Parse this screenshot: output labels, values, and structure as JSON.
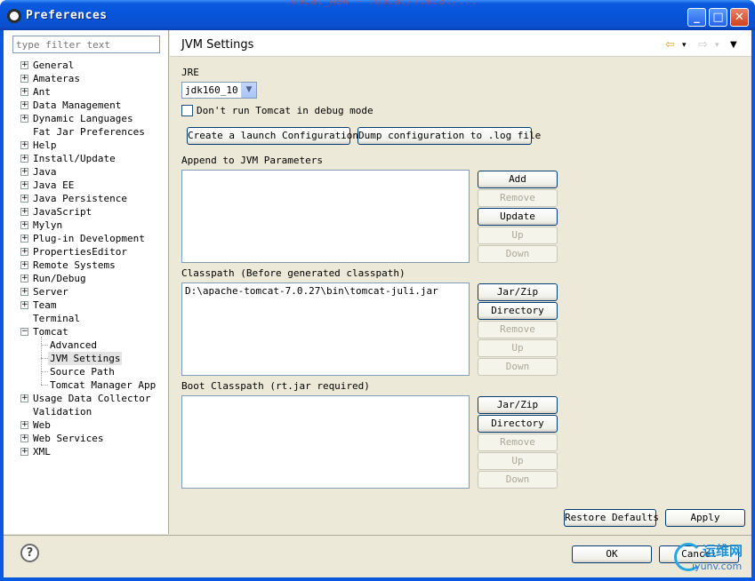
{
  "window": {
    "title": "Preferences",
    "background_title": "Tomcat_new - Tomcat/Tomcat/... ",
    "minimize_label": "_",
    "maximize_label": "□",
    "close_label": "✕"
  },
  "sidebar": {
    "filter_placeholder": "type filter text",
    "items": [
      {
        "label": "General",
        "expand": "+"
      },
      {
        "label": "Amateras",
        "expand": "+"
      },
      {
        "label": "Ant",
        "expand": "+"
      },
      {
        "label": "Data Management",
        "expand": "+"
      },
      {
        "label": "Dynamic Languages",
        "expand": "+"
      },
      {
        "label": "Fat Jar Preferences",
        "expand": ""
      },
      {
        "label": "Help",
        "expand": "+"
      },
      {
        "label": "Install/Update",
        "expand": "+"
      },
      {
        "label": "Java",
        "expand": "+"
      },
      {
        "label": "Java EE",
        "expand": "+"
      },
      {
        "label": "Java Persistence",
        "expand": "+"
      },
      {
        "label": "JavaScript",
        "expand": "+"
      },
      {
        "label": "Mylyn",
        "expand": "+"
      },
      {
        "label": "Plug-in Development",
        "expand": "+"
      },
      {
        "label": "PropertiesEditor",
        "expand": "+"
      },
      {
        "label": "Remote Systems",
        "expand": "+"
      },
      {
        "label": "Run/Debug",
        "expand": "+"
      },
      {
        "label": "Server",
        "expand": "+"
      },
      {
        "label": "Team",
        "expand": "+"
      },
      {
        "label": "Terminal",
        "expand": ""
      },
      {
        "label": "Tomcat",
        "expand": "−"
      },
      {
        "label": "Advanced",
        "expand": "",
        "child": true
      },
      {
        "label": "JVM Settings",
        "expand": "",
        "child": true,
        "selected": true
      },
      {
        "label": "Source Path",
        "expand": "",
        "child": true
      },
      {
        "label": "Tomcat Manager App",
        "expand": "",
        "child": true
      },
      {
        "label": "Usage Data Collector",
        "expand": "+"
      },
      {
        "label": "Validation",
        "expand": ""
      },
      {
        "label": "Web",
        "expand": "+"
      },
      {
        "label": "Web Services",
        "expand": "+"
      },
      {
        "label": "XML",
        "expand": "+"
      }
    ]
  },
  "page": {
    "title": "JVM Settings",
    "nav_back": "⇦",
    "nav_back_menu": "▾",
    "nav_forward": "⇨",
    "nav_forward_menu": "▾",
    "view_menu": "▼",
    "jre_label": "JRE",
    "jre_value": "jdk160_10",
    "jre_arrow": "▼",
    "debug_checkbox_label": "Don't run Tomcat in debug mode",
    "create_launch_button": "Create a launch Configuration",
    "dump_config_button": "Dump configuration to .log file",
    "append_label": "Append to JVM Parameters",
    "append_buttons": {
      "add": "Add",
      "remove": "Remove",
      "update": "Update",
      "up": "Up",
      "down": "Down"
    },
    "classpath_label": "Classpath (Before generated classpath)",
    "classpath_entries": [
      "D:\\apache-tomcat-7.0.27\\bin\\tomcat-juli.jar"
    ],
    "classpath_buttons": {
      "jarzip": "Jar/Zip",
      "directory": "Directory",
      "remove": "Remove",
      "up": "Up",
      "down": "Down"
    },
    "boot_label": "Boot Classpath (rt.jar required)",
    "boot_buttons": {
      "jarzip": "Jar/Zip",
      "directory": "Directory",
      "remove": "Remove",
      "up": "Up",
      "down": "Down"
    },
    "restore_defaults": "Restore Defaults",
    "apply": "Apply"
  },
  "footer": {
    "help_symbol": "?",
    "ok": "OK",
    "cancel": "Cancel",
    "watermark_cn": "运维网",
    "watermark_url": "iyunv.com"
  }
}
